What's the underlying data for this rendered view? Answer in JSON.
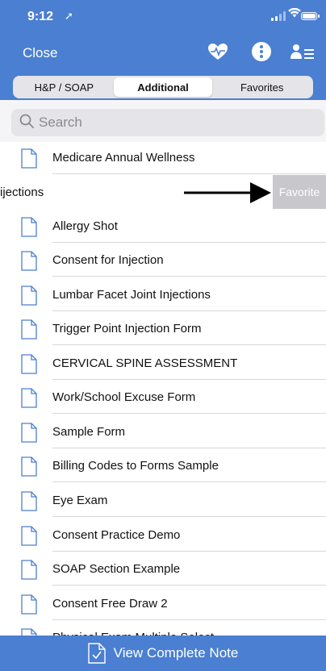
{
  "status_bar": {
    "time": "9:12",
    "location_glyph": "location-arrow"
  },
  "nav": {
    "close_label": "Close",
    "icons": [
      "heart-pulse-icon",
      "more-options-icon",
      "user-list-icon"
    ],
    "accent": "#4a7fd1"
  },
  "tabs": [
    {
      "label": "H&P / SOAP",
      "active": false
    },
    {
      "label": "Additional",
      "active": true
    },
    {
      "label": "Favorites",
      "active": false
    }
  ],
  "search": {
    "placeholder": "Search",
    "value": ""
  },
  "swiped_row": {
    "label": "ijections",
    "action_label": "Favorite"
  },
  "forms": [
    "Medicare Annual Wellness",
    "Allergy Shot",
    "Consent for Injection",
    "Lumbar Facet Joint Injections",
    "Trigger Point Injection Form",
    "CERVICAL SPINE ASSESSMENT",
    "Work/School Excuse Form",
    "Sample Form",
    "Billing Codes to Forms Sample",
    "Eye Exam",
    "Consent Practice Demo",
    "SOAP Section Example",
    "Consent Free Draw 2",
    "Physical Exam Multiple Select"
  ],
  "bottom": {
    "label": "View Complete Note"
  }
}
